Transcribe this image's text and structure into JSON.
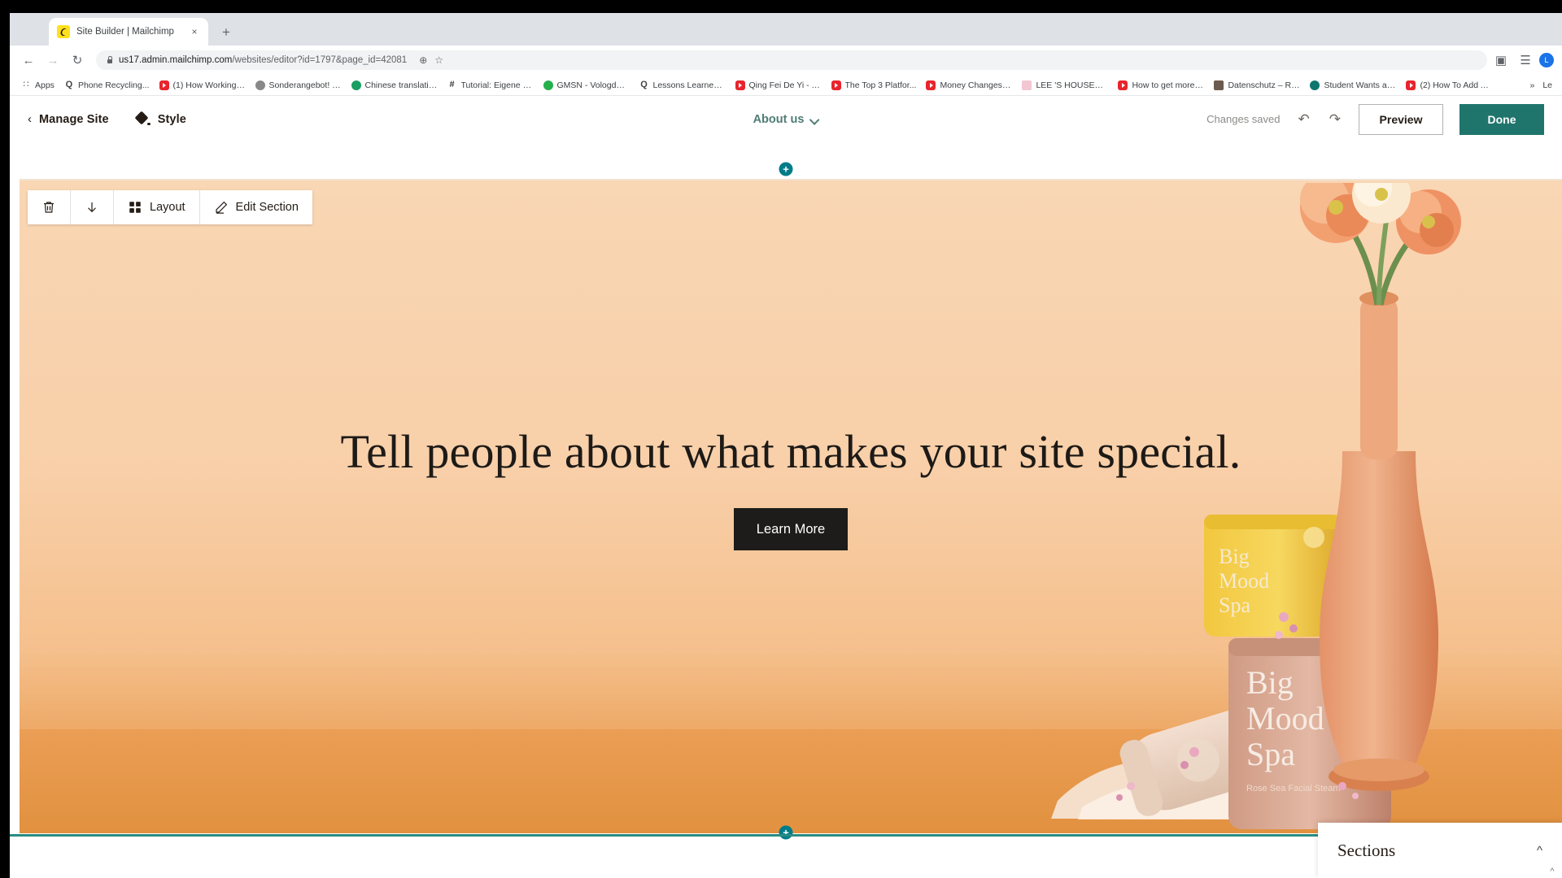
{
  "browser": {
    "tab": {
      "title": "Site Builder | Mailchimp",
      "favicon": "mailchimp-favicon",
      "close": "×"
    },
    "new_tab": "+",
    "nav": {
      "back": "←",
      "forward": "→",
      "reload": "↻"
    },
    "omnibox": {
      "secure_icon": "lock-icon",
      "url_host": "us17.admin.mailchimp.com",
      "url_path": "/websites/editor?id=1797&page_id=42081",
      "zoom_icon": "⊕",
      "bookmark_icon": "☆",
      "extension_icon": "▣",
      "profile_initial": "L"
    },
    "bookmarks": [
      {
        "label": "Apps",
        "icon": "apps-grid-icon",
        "style": "apps"
      },
      {
        "label": "Phone Recycling...",
        "icon": "search-q-icon",
        "style": "grayq"
      },
      {
        "label": "(1) How Working a...",
        "icon": "youtube-icon",
        "style": "yt"
      },
      {
        "label": "Sonderangebot! |...",
        "icon": "check-circle-icon",
        "style": "circ",
        "color": "#888888"
      },
      {
        "label": "Chinese translatio...",
        "icon": "green-circle-icon",
        "style": "circ",
        "color": "#1a9e63"
      },
      {
        "label": "Tutorial: Eigene Fa...",
        "icon": "hash-icon",
        "style": "hash"
      },
      {
        "label": "GMSN - Vologda,...",
        "icon": "green-circle-icon",
        "style": "circ",
        "color": "#25b04d"
      },
      {
        "label": "Lessons Learned f...",
        "icon": "gray-dots-icon",
        "style": "grayq"
      },
      {
        "label": "Qing Fei De Yi - Y...",
        "icon": "youtube-icon",
        "style": "yt"
      },
      {
        "label": "The Top 3 Platfor...",
        "icon": "youtube-icon",
        "style": "yt"
      },
      {
        "label": "Money Changes E...",
        "icon": "youtube-icon",
        "style": "yt"
      },
      {
        "label": "LEE 'S HOUSE—...",
        "icon": "pink-icon",
        "style": "pale"
      },
      {
        "label": "How to get more v...",
        "icon": "youtube-icon",
        "style": "yt"
      },
      {
        "label": "Datenschutz – Re...",
        "icon": "photo-icon",
        "style": "img"
      },
      {
        "label": "Student Wants an...",
        "icon": "teal-circle-icon",
        "style": "circ",
        "color": "#0f766e"
      },
      {
        "label": "(2) How To Add A...",
        "icon": "youtube-icon",
        "style": "yt"
      }
    ],
    "bookmarks_overflow": "»",
    "bookmarks_last": "Le"
  },
  "appbar": {
    "back_chevron": "‹",
    "manage_site": "Manage Site",
    "style": "Style",
    "style_icon": "paint-diamond-icon",
    "page_selector": {
      "label": "About us",
      "caret_icon": "chevron-down-icon"
    },
    "changes_saved": "Changes saved",
    "undo_icon": "↶",
    "redo_icon": "↷",
    "preview": "Preview",
    "done": "Done"
  },
  "section_toolbar": {
    "delete_icon": "trash-icon",
    "move_down_icon": "arrow-down-icon",
    "layout_label": "Layout",
    "layout_icon": "grid-icon",
    "edit_label": "Edit Section",
    "edit_icon": "pencil-icon"
  },
  "canvas": {
    "add_section_top": "+",
    "add_section_bottom": "+",
    "hero": {
      "heading": "Tell people about what makes your site special.",
      "cta_label": "Learn More",
      "product_labels": [
        "Big",
        "Mood",
        "Spa"
      ],
      "product_sub": "Rose Sea Facial Steam"
    }
  },
  "sections_panel": {
    "title": "Sections",
    "collapse_icon": "chevron-up-icon"
  },
  "colors": {
    "brand_teal": "#1f756c",
    "accent_dot": "#007c89",
    "page_select_text": "#4f7d76",
    "hero_bg_top": "#f9d6b4",
    "hero_bg_bottom": "#e79a4f",
    "cta_bg": "#1d1c1a"
  }
}
